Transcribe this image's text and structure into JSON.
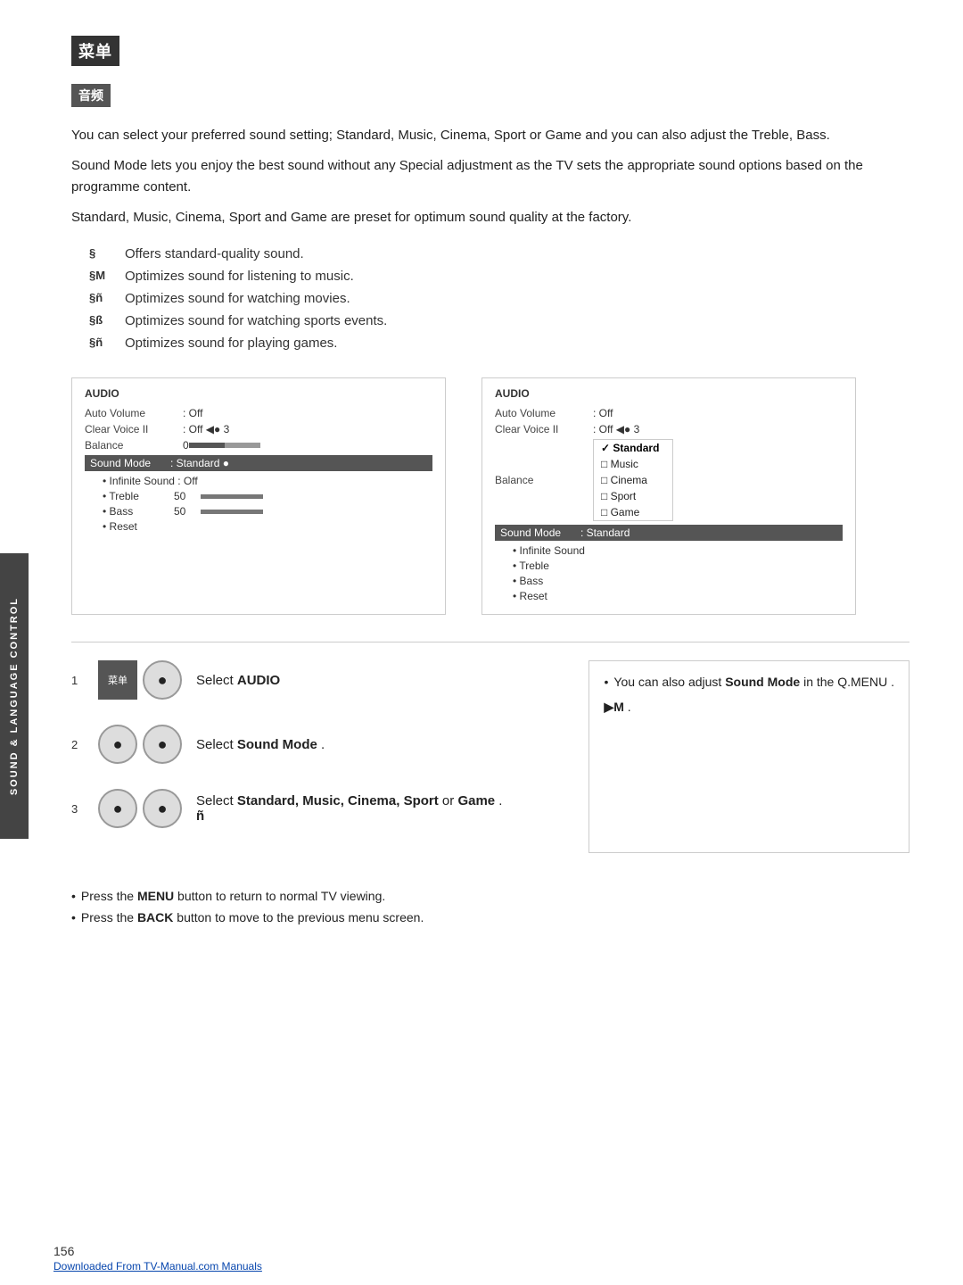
{
  "header": {
    "logo_text": "菜单",
    "sub_logo_text": "音频",
    "page_number": "156",
    "tv_manual_link": "Downloaded From TV-Manual.com Manuals"
  },
  "side_tab": {
    "label": "SOUND & LANGUAGE CONTROL"
  },
  "intro_paragraphs": [
    "You can select your preferred sound setting; Standard, Music, Cinema, Sport or Game and you can also adjust the Treble, Bass.",
    "Sound Mode lets you enjoy the best sound without any Special adjustment as the TV sets the appropriate sound options based on the programme content.",
    "Standard, Music, Cinema, Sport and Game are preset for optimum sound quality at the factory."
  ],
  "features": [
    {
      "icon": "§",
      "desc": "Offers standard-quality sound."
    },
    {
      "icon": "§M",
      "desc": "Optimizes sound for listening to music."
    },
    {
      "icon": "§ñ",
      "desc": "Optimizes sound for watching movies."
    },
    {
      "icon": "§ß",
      "desc": "Optimizes sound for watching sports events."
    },
    {
      "icon": "§ñ",
      "desc": "Optimizes sound for playing games."
    }
  ],
  "audio_panel_left": {
    "title": "AUDIO",
    "rows": [
      {
        "label": "Auto Volume",
        "value": ": Off"
      },
      {
        "label": "Clear Voice II",
        "value": ": Off  ◀● 3"
      },
      {
        "label": "Balance",
        "value": "0"
      }
    ],
    "highlighted": {
      "label": "Sound Mode",
      "value": ": Standard  ●"
    },
    "sub_rows": [
      {
        "label": "• Infinite Sound : Off",
        "value": ""
      },
      {
        "label": "• Treble",
        "value": "50"
      },
      {
        "label": "• Bass",
        "value": "50"
      },
      {
        "label": "• Reset",
        "value": ""
      }
    ]
  },
  "audio_panel_right": {
    "title": "AUDIO",
    "rows": [
      {
        "label": "Auto Volume",
        "value": ": Off"
      },
      {
        "label": "Clear Voice II",
        "value": ": Off  ◀● 3"
      },
      {
        "label": "Balance",
        "value": ""
      }
    ],
    "highlighted": {
      "label": "Sound Mode",
      "value": ": Standard"
    },
    "sub_rows": [
      {
        "label": "• Infinite Sound",
        "value": ""
      },
      {
        "label": "• Treble",
        "value": ""
      },
      {
        "label": "• Bass",
        "value": ""
      },
      {
        "label": "• Reset",
        "value": ""
      }
    ],
    "dropdown": {
      "items": [
        {
          "label": "✓ Standard",
          "checked": true
        },
        {
          "label": "□ Music",
          "checked": false
        },
        {
          "label": "□ Cinema",
          "checked": false
        },
        {
          "label": "□ Sport",
          "checked": false
        },
        {
          "label": "□ Game",
          "checked": false
        }
      ]
    }
  },
  "steps": [
    {
      "number": "1",
      "buttons": [
        "menu",
        "circle"
      ],
      "desc": "Select AUDIO"
    },
    {
      "number": "2",
      "buttons": [
        "circle",
        "circle"
      ],
      "desc": "Select Sound Mode ."
    },
    {
      "number": "3",
      "buttons": [
        "circle",
        "circle"
      ],
      "desc": "Select Standard, Music, Cinema, Sport or Game ."
    }
  ],
  "note_box": {
    "lines": [
      "• You can also adjust Sound Mode in the Q.MENU .",
      "▶M ."
    ]
  },
  "footer_notes": [
    "• Press the MENU button to return to normal TV viewing.",
    "• Press the BACK button to move to the previous menu screen."
  ]
}
